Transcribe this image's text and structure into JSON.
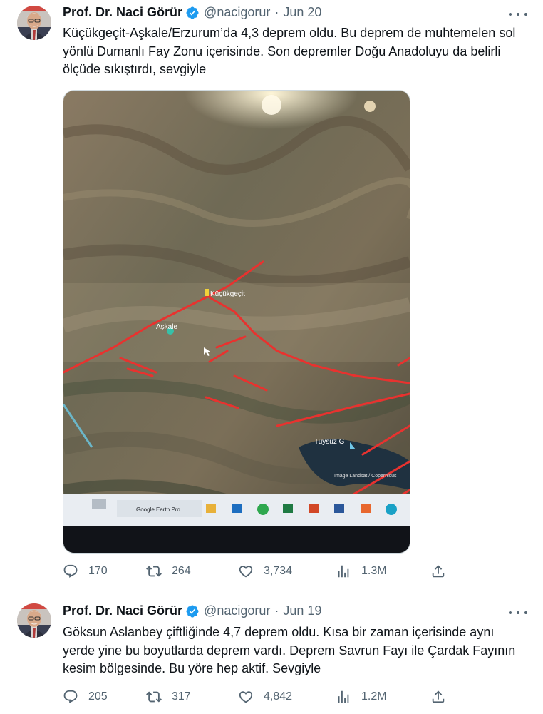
{
  "tweets": [
    {
      "author": "Prof. Dr. Naci Görür",
      "handle": "@nacigorur",
      "separator": "·",
      "date": "Jun 20",
      "text": "Küçükgeçit-Aşkale/Erzurum’da 4,3 deprem oldu. Bu deprem de muhtemelen sol yönlü Dumanlı Fay Zonu içerisinde. Son depremler Doğu Anadoluyu da belirli ölçüde sıkıştırdı, sevgiyle",
      "media": {
        "labels": {
          "town1": "Küçükgeçit",
          "town2": "Aşkale",
          "lake": "Tuysuz G",
          "credit": "Image Landsat / Copernicus",
          "taskbar_app": "Google Earth Pro"
        }
      },
      "replies": "170",
      "retweets": "264",
      "likes": "3,734",
      "views": "1.3M"
    },
    {
      "author": "Prof. Dr. Naci Görür",
      "handle": "@nacigorur",
      "separator": "·",
      "date": "Jun 19",
      "text": "Göksun Aslanbey çiftliğinde 4,7 deprem oldu. Kısa bir zaman içerisinde aynı yerde yine bu boyutlarda deprem vardı. Deprem Savrun Fayı ile Çardak Fayının kesim bölgesinde. Bu yöre hep aktif. Sevgiyle",
      "replies": "205",
      "retweets": "317",
      "likes": "4,842",
      "views": "1.2M"
    }
  ],
  "colors": {
    "text": "#0f1419",
    "secondary": "#536471",
    "verified": "#1d9bf0",
    "fault_lines": "#e8322f",
    "divider": "#eff3f4"
  },
  "icons": [
    "reply-icon",
    "retweet-icon",
    "like-icon",
    "views-icon",
    "share-icon",
    "verified-badge-icon",
    "more-icon"
  ]
}
